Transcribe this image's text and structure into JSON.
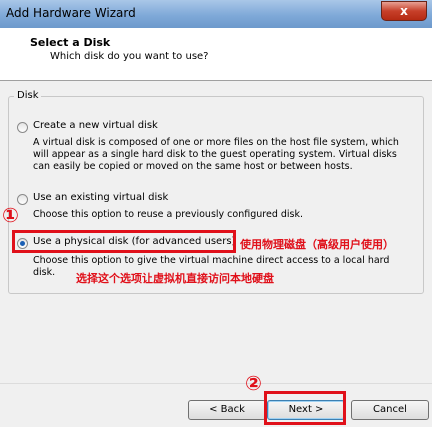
{
  "window": {
    "title": "Add Hardware Wizard",
    "close_glyph": "x"
  },
  "header": {
    "title": "Select a Disk",
    "subtitle": "Which disk do you want to use?"
  },
  "group": {
    "label": "Disk",
    "options": [
      {
        "label": "Create a new virtual disk",
        "description": "A virtual disk is composed of one or more files on the host file system, which will appear as a single hard disk to the guest operating system. Virtual disks can easily be copied or moved on the same host or between hosts.",
        "selected": false
      },
      {
        "label": "Use an existing virtual disk",
        "description": "Choose this option to reuse a previously configured disk.",
        "selected": false
      },
      {
        "label": "Use a physical disk (for advanced users)",
        "description": "Choose this option to give the virtual machine direct access to a local hard disk.",
        "selected": true
      }
    ]
  },
  "annotations": {
    "step1_marker": "①",
    "step2_marker": "②",
    "zh_option_note": "使用物理磁盘（高级用户使用）",
    "zh_desc_note": "选择这个选项让虚拟机直接访问本地硬盘",
    "highlight_color": "#e0101a"
  },
  "buttons": {
    "back": "< Back",
    "next": "Next >",
    "cancel": "Cancel"
  }
}
